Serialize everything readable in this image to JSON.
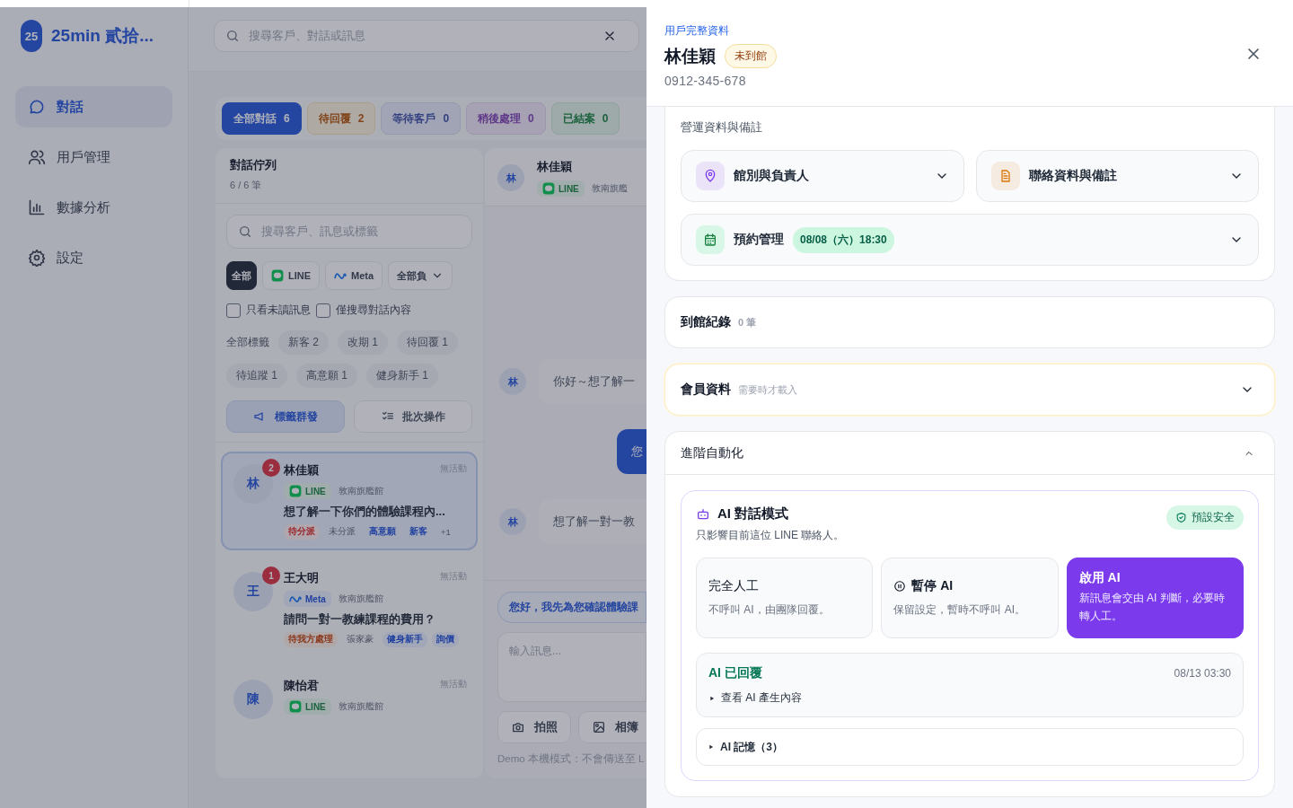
{
  "sidebar": {
    "logo": "25",
    "app_name": "25min 貳拾...",
    "nav": [
      {
        "label": "對話",
        "selected": true
      },
      {
        "label": "用戶管理",
        "selected": false
      },
      {
        "label": "數據分析",
        "selected": false
      },
      {
        "label": "設定",
        "selected": false
      }
    ]
  },
  "search": {
    "placeholder": "搜尋客戶、對話或訊息"
  },
  "status_tabs": [
    {
      "label": "全部對話",
      "count": "6",
      "selected": true,
      "kind": "all"
    },
    {
      "label": "待回覆",
      "count": "2",
      "selected": false,
      "kind": "pending"
    },
    {
      "label": "等待客戶",
      "count": "0",
      "selected": false,
      "kind": "waiting"
    },
    {
      "label": "稍後處理",
      "count": "0",
      "selected": false,
      "kind": "later"
    },
    {
      "label": "已結案",
      "count": "0",
      "selected": false,
      "kind": "closed"
    }
  ],
  "queue": {
    "title": "對話佇列",
    "count": "6 / 6 筆",
    "search_placeholder": "搜尋客戶、訊息或標籤",
    "channel_filters": [
      {
        "label": "全部",
        "kind": "all",
        "selected": true
      },
      {
        "label": "LINE",
        "kind": "line",
        "selected": false
      },
      {
        "label": "Meta",
        "kind": "meta",
        "selected": false
      }
    ],
    "owner_filter": "全部負",
    "checkboxes": [
      {
        "label": "只看未讀訊息",
        "checked": false
      },
      {
        "label": "僅搜尋對話內容",
        "checked": false
      }
    ],
    "tag_filters": [
      {
        "label": "全部標籤",
        "kind": "plain"
      },
      {
        "label": "新客 2",
        "kind": "chip"
      },
      {
        "label": "改期 1",
        "kind": "chip"
      },
      {
        "label": "待回覆 1",
        "kind": "chip"
      },
      {
        "label": "待追蹤 1",
        "kind": "chip"
      },
      {
        "label": "高意願 1",
        "kind": "chip"
      },
      {
        "label": "健身新手 1",
        "kind": "chip"
      }
    ],
    "actions": [
      {
        "label": "標籤群發",
        "kind": "primary"
      },
      {
        "label": "批次操作",
        "kind": "secondary"
      }
    ],
    "conversations": [
      {
        "avatar": "林",
        "unread": "2",
        "name": "林佳穎",
        "time": "無活動",
        "channel": {
          "label": "LINE",
          "kind": "line"
        },
        "branch": "敦南旗艦館",
        "preview": "想了解一下你們的體驗課程內...",
        "selected": true,
        "tags": [
          {
            "label": "待分派",
            "kind": "urgent"
          },
          {
            "label": "未分派",
            "kind": "plain"
          },
          {
            "label": "高意願",
            "kind": "tag"
          },
          {
            "label": "新客",
            "kind": "tag"
          },
          {
            "label": "+1",
            "kind": "plain"
          }
        ]
      },
      {
        "avatar": "王",
        "unread": "1",
        "name": "王大明",
        "time": "無活動",
        "channel": {
          "label": "Meta",
          "kind": "meta"
        },
        "branch": "敦南旗艦館",
        "preview": "請問一對一教練課程的費用？",
        "selected": false,
        "tags": [
          {
            "label": "待我方處理",
            "kind": "status"
          },
          {
            "label": "張家豪",
            "kind": "plain"
          },
          {
            "label": "健身新手",
            "kind": "tag"
          },
          {
            "label": "詢價",
            "kind": "tag"
          }
        ]
      },
      {
        "avatar": "陳",
        "name": "陳怡君",
        "time": "無活動",
        "channel": {
          "label": "LINE",
          "kind": "line"
        },
        "branch": "敦南旗艦館",
        "selected": false
      }
    ]
  },
  "chat": {
    "avatar": "林",
    "name": "林佳穎",
    "channel": {
      "label": "LINE",
      "kind": "line"
    },
    "branch": "敦南旗艦",
    "messages": [
      {
        "kind": "incoming",
        "avatar": "林",
        "text": "你好～想了解一"
      },
      {
        "kind": "outgoing",
        "text": "您"
      },
      {
        "kind": "incoming",
        "avatar": "林",
        "text": "想了解一對一教"
      }
    ],
    "suggestion": "您好，我先為您確認體驗課",
    "input_placeholder": "輸入訊息...",
    "attach": [
      "拍照",
      "相簿"
    ],
    "footer": "Demo 本機模式：不會傳送至 L"
  },
  "drawer": {
    "eyebrow": "用戶完整資料",
    "name": "林佳穎",
    "status_badge": "未到館",
    "phone": "0912-345-678",
    "ops": {
      "title": "營運資料與備註",
      "panels": [
        {
          "label": "館別與負責人",
          "color": "#7c3aed"
        },
        {
          "label": "聯絡資料與備註",
          "color": "#d97706"
        }
      ],
      "booking": {
        "label": "預約管理",
        "badge": "08/08（六）18:30"
      }
    },
    "visits": {
      "title": "到館紀錄",
      "count": "0 筆"
    },
    "member": {
      "title": "會員資料",
      "hint": "需要時才載入"
    },
    "automation": {
      "title": "進階自動化",
      "expanded": true,
      "ai_mode": {
        "title": "AI 對話模式",
        "note": "只影響目前這位 LINE 聯絡人。",
        "badge": "預設安全",
        "options": [
          {
            "kind": "manual",
            "title": "完全人工",
            "desc": "不呼叫 AI，由團隊回覆。",
            "selected": false
          },
          {
            "kind": "pause",
            "title": "暫停 AI",
            "desc": "保留設定，暫時不呼叫 AI。",
            "selected": false
          },
          {
            "kind": "auto",
            "title": "啟用 AI",
            "desc": "新訊息會交由 AI 判斷，必要時轉人工。",
            "selected": true
          }
        ],
        "last_reply": {
          "title": "AI 已回覆",
          "time": "08/13 03:30",
          "toggle": "查看 AI 產生內容"
        },
        "memory": "AI 記憶（3）"
      }
    }
  }
}
